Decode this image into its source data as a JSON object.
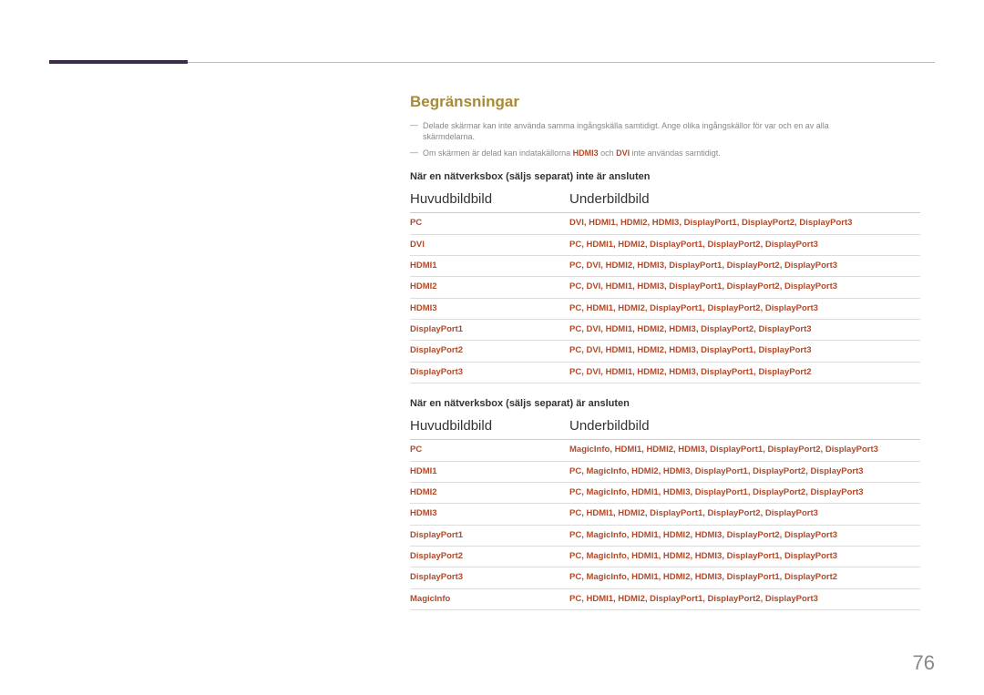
{
  "section_title": "Begränsningar",
  "notes": {
    "n1a": "Delade skärmar kan inte använda samma ingångskälla samtidigt. Ange olika ingångskällor för var och en av alla",
    "n1b": "skärmdelarna.",
    "n2a": "Om skärmen är delad kan indatakällorna ",
    "n2_hdmi3": "HDMI3",
    "n2b": " och ",
    "n2_dvi": "DVI",
    "n2c": " inte användas samtidigt."
  },
  "table1": {
    "title": "När en nätverksbox (säljs separat) inte är ansluten",
    "col1": "Huvudbildbild",
    "col2": "Underbildbild",
    "rows": [
      {
        "main": "PC",
        "sub": "DVI, HDMI1, HDMI2, HDMI3, DisplayPort1, DisplayPort2, DisplayPort3"
      },
      {
        "main": "DVI",
        "sub": "PC, HDMI1, HDMI2, DisplayPort1, DisplayPort2, DisplayPort3"
      },
      {
        "main": "HDMI1",
        "sub": "PC, DVI, HDMI2, HDMI3, DisplayPort1, DisplayPort2, DisplayPort3"
      },
      {
        "main": "HDMI2",
        "sub": "PC, DVI, HDMI1, HDMI3, DisplayPort1, DisplayPort2, DisplayPort3"
      },
      {
        "main": "HDMI3",
        "sub": "PC, HDMI1, HDMI2, DisplayPort1, DisplayPort2, DisplayPort3"
      },
      {
        "main": "DisplayPort1",
        "sub": "PC, DVI, HDMI1, HDMI2, HDMI3, DisplayPort2, DisplayPort3"
      },
      {
        "main": "DisplayPort2",
        "sub": "PC, DVI, HDMI1, HDMI2, HDMI3, DisplayPort1, DisplayPort3"
      },
      {
        "main": "DisplayPort3",
        "sub": "PC, DVI, HDMI1, HDMI2, HDMI3, DisplayPort1, DisplayPort2"
      }
    ]
  },
  "table2": {
    "title": "När en nätverksbox (säljs separat) är ansluten",
    "col1": "Huvudbildbild",
    "col2": "Underbildbild",
    "rows": [
      {
        "main": "PC",
        "sub": "MagicInfo, HDMI1, HDMI2, HDMI3, DisplayPort1, DisplayPort2, DisplayPort3"
      },
      {
        "main": "HDMI1",
        "sub": "PC, MagicInfo, HDMI2, HDMI3, DisplayPort1, DisplayPort2, DisplayPort3"
      },
      {
        "main": "HDMI2",
        "sub": "PC, MagicInfo, HDMI1, HDMI3, DisplayPort1, DisplayPort2, DisplayPort3"
      },
      {
        "main": "HDMI3",
        "sub": "PC, HDMI1, HDMI2, DisplayPort1, DisplayPort2, DisplayPort3"
      },
      {
        "main": "DisplayPort1",
        "sub": "PC, MagicInfo, HDMI1, HDMI2, HDMI3, DisplayPort2, DisplayPort3"
      },
      {
        "main": "DisplayPort2",
        "sub": "PC, MagicInfo, HDMI1, HDMI2, HDMI3, DisplayPort1, DisplayPort3"
      },
      {
        "main": "DisplayPort3",
        "sub": "PC, MagicInfo, HDMI1, HDMI2, HDMI3, DisplayPort1, DisplayPort2"
      },
      {
        "main": "MagicInfo",
        "sub": "PC, HDMI1, HDMI2, DisplayPort1, DisplayPort2, DisplayPort3"
      }
    ]
  },
  "page_number": "76"
}
